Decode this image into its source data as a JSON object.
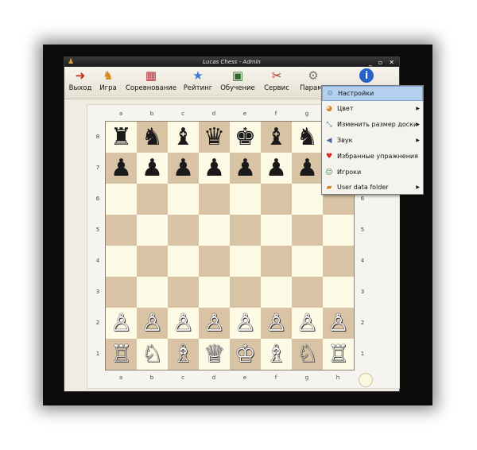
{
  "window": {
    "title": "Lucas Chess - Admin",
    "controls": [
      "_",
      "▫",
      "✕"
    ]
  },
  "toolbar": {
    "items": [
      {
        "label": "Выход",
        "icon": "exit-icon"
      },
      {
        "label": "Игра",
        "icon": "game-icon"
      },
      {
        "label": "Соревнование",
        "icon": "competition-icon"
      },
      {
        "label": "Рейтинг",
        "icon": "star-icon"
      },
      {
        "label": "Обучение",
        "icon": "training-icon"
      },
      {
        "label": "Сервис",
        "icon": "tools-icon"
      },
      {
        "label": "Параме",
        "icon": "gear-icon"
      },
      {
        "label": "",
        "icon": "info-icon"
      }
    ]
  },
  "board": {
    "files": [
      "a",
      "b",
      "c",
      "d",
      "e",
      "f",
      "g",
      "h"
    ],
    "ranks": [
      "8",
      "7",
      "6",
      "5",
      "4",
      "3",
      "2",
      "1"
    ],
    "rows": [
      [
        "♜",
        "♞",
        "♝",
        "♛",
        "♚",
        "♝",
        "♞",
        "♜"
      ],
      [
        "♟",
        "♟",
        "♟",
        "♟",
        "♟",
        "♟",
        "♟",
        "♟"
      ],
      [
        "",
        "",
        "",
        "",
        "",
        "",
        "",
        ""
      ],
      [
        "",
        "",
        "",
        "",
        "",
        "",
        "",
        ""
      ],
      [
        "",
        "",
        "",
        "",
        "",
        "",
        "",
        ""
      ],
      [
        "",
        "",
        "",
        "",
        "",
        "",
        "",
        ""
      ],
      [
        "♙",
        "♙",
        "♙",
        "♙",
        "♙",
        "♙",
        "♙",
        "♙"
      ],
      [
        "♖",
        "♘",
        "♗",
        "♕",
        "♔",
        "♗",
        "♘",
        "♖"
      ]
    ]
  },
  "menu": {
    "items": [
      {
        "label": "Настройки",
        "icon": "settings-icon",
        "submenu": false,
        "selected": true
      },
      {
        "label": "Цвет",
        "icon": "palette-icon",
        "submenu": true,
        "selected": false
      },
      {
        "label": "Изменить размер доски",
        "icon": "resize-icon",
        "submenu": true,
        "selected": false
      },
      {
        "label": "Звук",
        "icon": "sound-icon",
        "submenu": true,
        "selected": false
      },
      {
        "label": "Избранные упражнения",
        "icon": "heart-icon",
        "submenu": false,
        "selected": false
      },
      {
        "label": "Игроки",
        "icon": "players-icon",
        "submenu": false,
        "selected": false
      },
      {
        "label": "User data folder",
        "icon": "folder-icon",
        "submenu": true,
        "selected": false
      }
    ]
  }
}
